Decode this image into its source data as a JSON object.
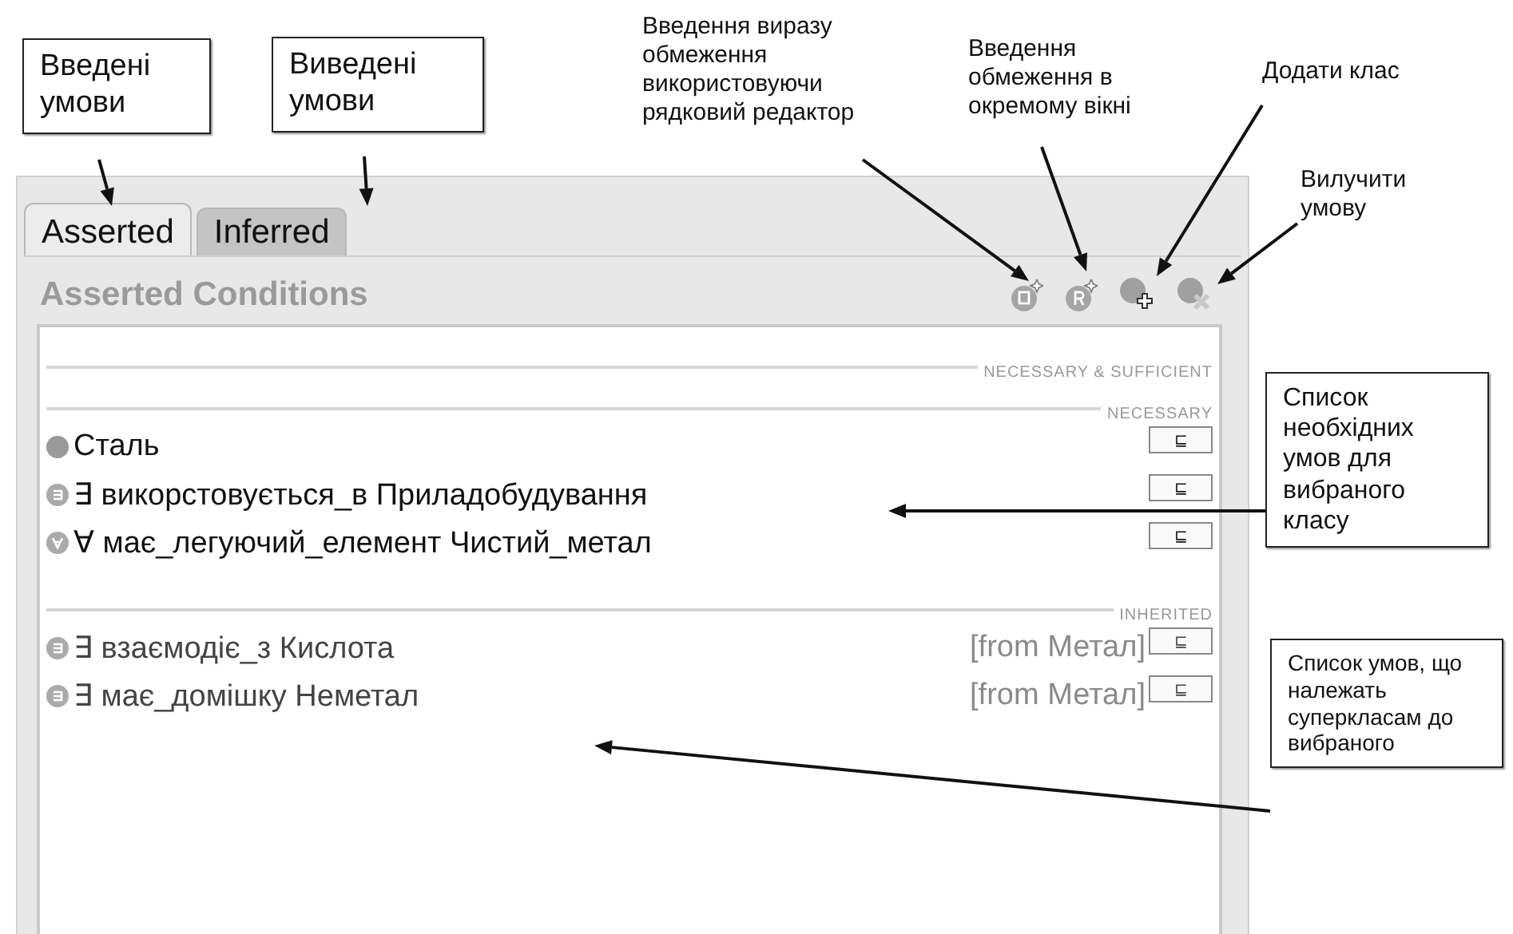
{
  "tabs": [
    {
      "label": "Asserted",
      "selected": true
    },
    {
      "label": "Inferred",
      "selected": false
    }
  ],
  "panel": {
    "title": "Asserted Conditions"
  },
  "sections": [
    {
      "kind": "own",
      "label": "NECESSARY & SUFFICIENT"
    },
    {
      "kind": "own",
      "label": "NECESSARY",
      "rows": [
        {
          "kind": "class",
          "text": "Сталь"
        },
        {
          "kind": "some",
          "text": "∃ викорстовується_в Приладобудування"
        },
        {
          "kind": "all",
          "text": "∀ має_легуючий_елемент Чистий_метал"
        }
      ]
    },
    {
      "kind": "inherited",
      "label": "INHERITED",
      "rows": [
        {
          "kind": "some",
          "text": "∃ взаємодіє_з Кислота",
          "from": "[from Метал]"
        },
        {
          "kind": "some",
          "text": "∃ має_домішку Неметал",
          "from": "[from Метал]"
        }
      ]
    }
  ],
  "subsumption_symbol": "⊑",
  "annotations": [
    {
      "text": "Введені умови",
      "boxed": true
    },
    {
      "text": "Виведені умови",
      "boxed": true
    },
    {
      "text": "Введення виразу обмеження використовуючи рядковий редактор",
      "boxed": false
    },
    {
      "text": "Введення обмеження в окремому вікні",
      "boxed": false
    },
    {
      "text": "Додати клас",
      "boxed": false
    },
    {
      "text": "Вилучити умову",
      "boxed": false
    },
    {
      "text": "Список необхідних умов для вибраного класу",
      "boxed": true
    },
    {
      "text": "Список умов, що належать суперкласам до вибраного",
      "boxed": true
    }
  ]
}
